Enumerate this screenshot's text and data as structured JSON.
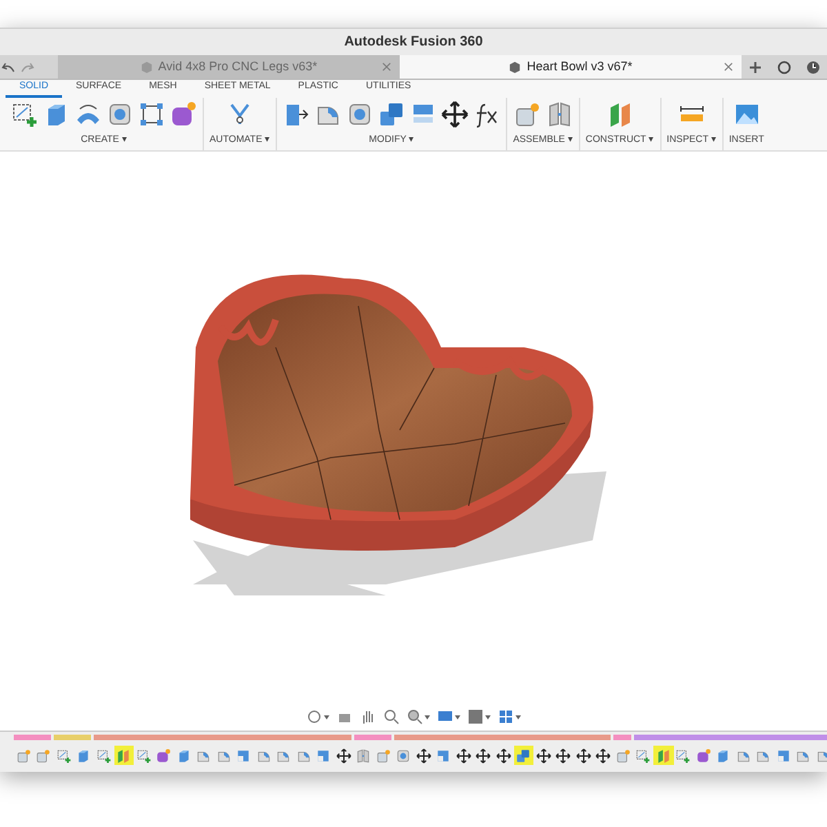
{
  "window": {
    "title": "Autodesk Fusion 360"
  },
  "doc_tabs": [
    {
      "label": "Avid 4x8 Pro CNC Legs v63*",
      "selected": false
    },
    {
      "label": "Heart Bowl v3 v67*",
      "selected": true
    }
  ],
  "workspace_tabs": [
    {
      "label": "SOLID",
      "selected": true
    },
    {
      "label": "SURFACE",
      "selected": false
    },
    {
      "label": "MESH",
      "selected": false
    },
    {
      "label": "SHEET METAL",
      "selected": false
    },
    {
      "label": "PLASTIC",
      "selected": false
    },
    {
      "label": "UTILITIES",
      "selected": false
    }
  ],
  "toolbar_groups": [
    {
      "label": "CREATE ▾",
      "tools": [
        {
          "kind": "sketch"
        },
        {
          "kind": "box"
        },
        {
          "kind": "revolve"
        },
        {
          "kind": "hole"
        },
        {
          "kind": "pattern"
        },
        {
          "kind": "form"
        }
      ]
    },
    {
      "label": "AUTOMATE ▾",
      "tools": [
        {
          "kind": "automate"
        }
      ]
    },
    {
      "label": "MODIFY ▾",
      "tools": [
        {
          "kind": "presspull"
        },
        {
          "kind": "fillet"
        },
        {
          "kind": "shell"
        },
        {
          "kind": "combine"
        },
        {
          "kind": "offset"
        },
        {
          "kind": "move"
        },
        {
          "kind": "fx"
        }
      ]
    },
    {
      "label": "ASSEMBLE ▾",
      "tools": [
        {
          "kind": "component"
        },
        {
          "kind": "joint"
        }
      ]
    },
    {
      "label": "CONSTRUCT ▾",
      "tools": [
        {
          "kind": "plane"
        }
      ]
    },
    {
      "label": "INSPECT ▾",
      "tools": [
        {
          "kind": "measure"
        }
      ]
    },
    {
      "label": "INSERT",
      "tools": [
        {
          "kind": "image"
        }
      ]
    }
  ],
  "timeline": {
    "groups": [
      {
        "color": "#f48fc0",
        "items": [
          {
            "kind": "body",
            "selected": false
          },
          {
            "kind": "body",
            "selected": false
          }
        ]
      },
      {
        "color": "#e8cf6a",
        "items": [
          {
            "kind": "sketch",
            "selected": false
          },
          {
            "kind": "extrude",
            "selected": false
          }
        ]
      },
      {
        "color": "#e89a8a",
        "items": [
          {
            "kind": "sketch",
            "selected": false
          },
          {
            "kind": "construct",
            "selected": true
          },
          {
            "kind": "sketch",
            "selected": false
          },
          {
            "kind": "form",
            "selected": false
          },
          {
            "kind": "extrude",
            "selected": false
          },
          {
            "kind": "fillet",
            "selected": false
          },
          {
            "kind": "fillet",
            "selected": false
          },
          {
            "kind": "chamfer",
            "selected": false
          },
          {
            "kind": "fillet",
            "selected": false
          },
          {
            "kind": "fillet",
            "selected": false
          },
          {
            "kind": "fillet",
            "selected": false
          },
          {
            "kind": "chamfer",
            "selected": false
          },
          {
            "kind": "move",
            "selected": false
          }
        ]
      },
      {
        "color": "#f48fc0",
        "items": [
          {
            "kind": "split",
            "selected": false
          },
          {
            "kind": "body",
            "selected": false
          }
        ]
      },
      {
        "color": "#e89a8a",
        "items": [
          {
            "kind": "shell",
            "selected": false
          },
          {
            "kind": "move",
            "selected": false
          },
          {
            "kind": "chamfer",
            "selected": false
          },
          {
            "kind": "move",
            "selected": false
          },
          {
            "kind": "move",
            "selected": false
          },
          {
            "kind": "move",
            "selected": false
          },
          {
            "kind": "combine",
            "selected": true
          },
          {
            "kind": "move",
            "selected": false
          },
          {
            "kind": "move",
            "selected": false
          },
          {
            "kind": "move",
            "selected": false
          },
          {
            "kind": "move",
            "selected": false
          }
        ]
      },
      {
        "color": "#f48fc0",
        "items": [
          {
            "kind": "body",
            "selected": false
          }
        ]
      },
      {
        "color": "#c08fe8",
        "items": [
          {
            "kind": "sketch",
            "selected": false
          },
          {
            "kind": "construct",
            "selected": true
          },
          {
            "kind": "sketch",
            "selected": false
          },
          {
            "kind": "form",
            "selected": false
          },
          {
            "kind": "extrude",
            "selected": false
          },
          {
            "kind": "fillet",
            "selected": false
          },
          {
            "kind": "fillet",
            "selected": false
          },
          {
            "kind": "chamfer",
            "selected": false
          },
          {
            "kind": "fillet",
            "selected": false
          },
          {
            "kind": "fillet",
            "selected": false
          }
        ]
      }
    ]
  }
}
